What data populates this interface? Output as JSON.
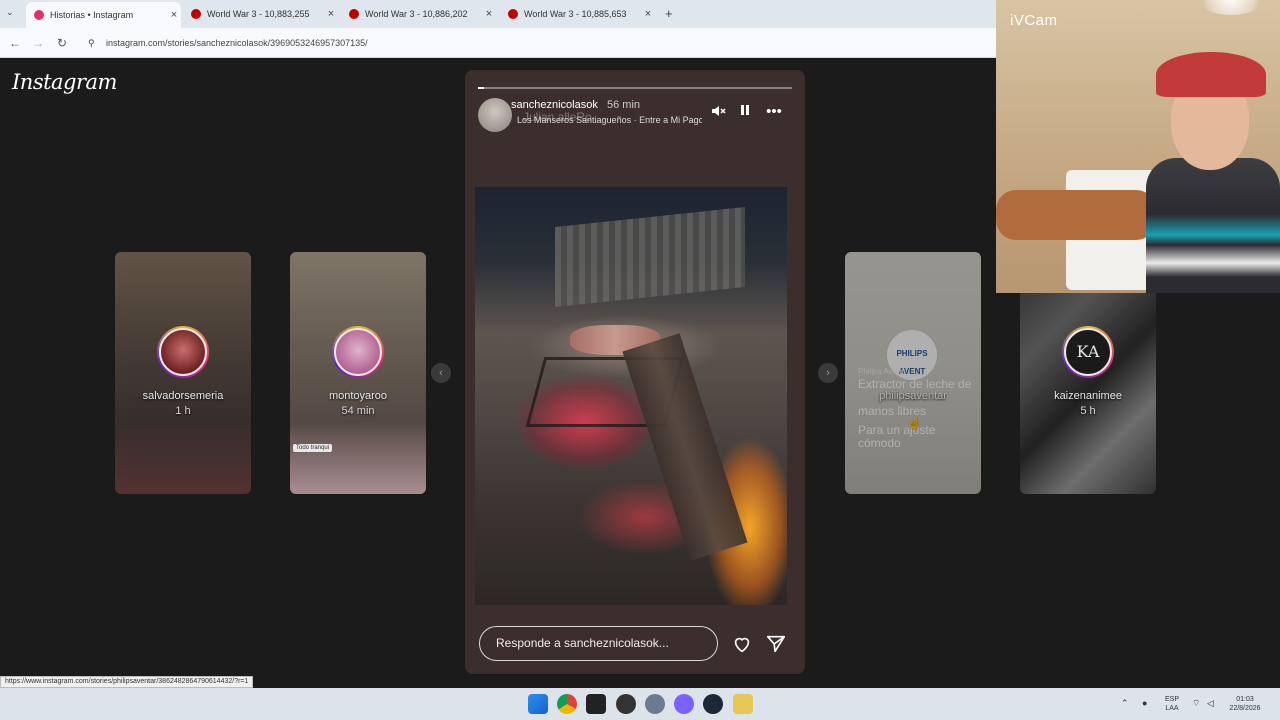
{
  "browser": {
    "tabs": [
      {
        "title": "Historias • Instagram",
        "favicon_color": "#e1306c",
        "active": true
      },
      {
        "title": "World War 3 - 10,883,255",
        "favicon_color": "#c00000",
        "active": false
      },
      {
        "title": "World War 3 - 10,886,202",
        "favicon_color": "#c00000",
        "active": false
      },
      {
        "title": "World War 3 - 10,885,653",
        "favicon_color": "#c00000",
        "active": false
      }
    ],
    "new_tab_label": "+",
    "url": "instagram.com/stories/sancheznicolasok/3969053246957307135/"
  },
  "instagram": {
    "logo": "Instagram",
    "side_stories_left": [
      {
        "username": "salvadorsemeria",
        "time": "1 h"
      },
      {
        "username": "montoyaroo",
        "time": "54 min",
        "caption": "Todo tranqui"
      }
    ],
    "side_stories_right": [
      {
        "username": "philipsaventar",
        "avatar_text": "PHILIPS AVENT",
        "ad_brand": "Philips Avent",
        "ad_line1": "Extractor de leche de",
        "ad_line2": "manos libres",
        "ad_line3": "Para un ajuste",
        "ad_line4": "cómodo"
      },
      {
        "username": "kaizenanimee",
        "time": "5 h",
        "avatar_text": "KA"
      }
    ],
    "prev_arrow": "‹",
    "next_arrow": "›",
    "story": {
      "username": "sancheznicolasok",
      "time": "56 min",
      "music": "Los Manseros Santiagueños · Entre a Mi Pago Sin Golpear",
      "music_ghost": "Julian alleRo",
      "progress": 0.02,
      "reply_placeholder": "Responde a sancheznicolasok..."
    }
  },
  "webcam": {
    "label": "iVCam"
  },
  "statusbar": {
    "url": "https://www.instagram.com/stories/philipsaventar/3862482864790614432/?r=1"
  },
  "taskbar": {
    "tray_lang_1": "ESP",
    "tray_lang_2": "LAA",
    "clock_time": "01:03",
    "clock_date": "22/8/2026"
  }
}
